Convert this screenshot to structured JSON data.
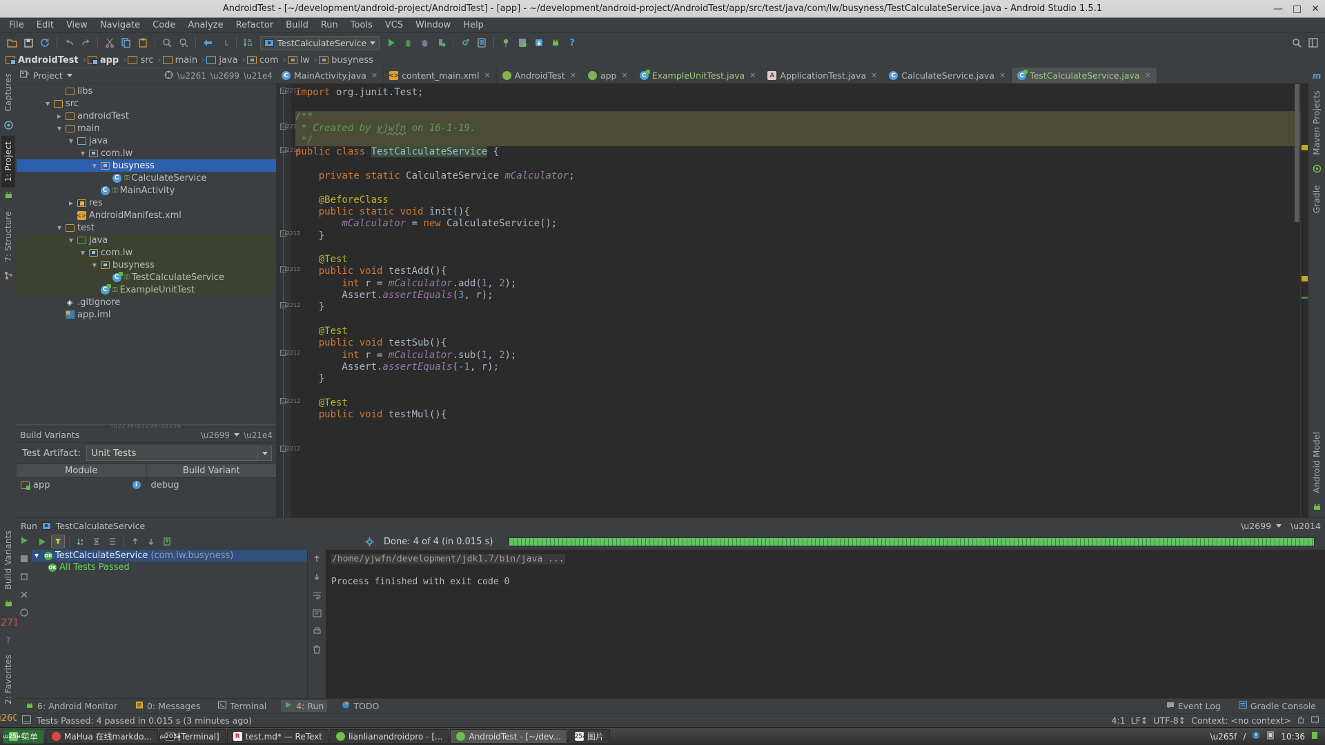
{
  "window": {
    "title": "AndroidTest - [~/development/android-project/AndroidTest] - [app] - ~/development/android-project/AndroidTest/app/src/test/java/com/lw/busyness/TestCalculateService.java - Android Studio 1.5.1",
    "minimize": "—",
    "maximize": "□",
    "close": "✕"
  },
  "menu": {
    "items": [
      "File",
      "Edit",
      "View",
      "Navigate",
      "Code",
      "Analyze",
      "Refactor",
      "Build",
      "Run",
      "Tools",
      "VCS",
      "Window",
      "Help"
    ]
  },
  "toolbar": {
    "run_config": "TestCalculateService",
    "icons": [
      "open-folder-icon",
      "save-all-icon",
      "sync-icon",
      "undo-icon",
      "redo-icon",
      "cut-icon",
      "copy-icon",
      "paste-icon",
      "find-icon",
      "replace-icon",
      "back-icon",
      "forward-icon",
      "sort-icon"
    ],
    "right_icons": [
      "search-everywhere-icon",
      "layout-icon"
    ]
  },
  "breadcrumb": {
    "items": [
      {
        "label": "AndroidTest",
        "icon": "module-icon",
        "bold": true
      },
      {
        "label": "app",
        "icon": "module-icon",
        "bold": true
      },
      {
        "label": "src",
        "icon": "folder-icon",
        "bold": false
      },
      {
        "label": "main",
        "icon": "folder-icon",
        "bold": false
      },
      {
        "label": "java",
        "icon": "source-folder-icon",
        "bold": false
      },
      {
        "label": "com",
        "icon": "package-icon",
        "bold": false
      },
      {
        "label": "lw",
        "icon": "package-icon",
        "bold": false
      },
      {
        "label": "busyness",
        "icon": "package-icon",
        "bold": false
      }
    ],
    "separator": "›"
  },
  "left_stripe": {
    "top": [
      "Captures",
      "1: Project",
      "7: Structure"
    ],
    "bottom": [
      "Build Variants",
      "2: Favorites"
    ]
  },
  "right_stripe": {
    "items": [
      "Maven Projects",
      "Gradle",
      "Android Model"
    ]
  },
  "project_panel": {
    "title": "Project",
    "tree": [
      {
        "label": "libs",
        "indent": 3,
        "arrow": "",
        "icon": "folder-icon",
        "state": "normal"
      },
      {
        "label": "src",
        "indent": 2,
        "arrow": "▼",
        "icon": "folder-icon",
        "state": "normal"
      },
      {
        "label": "androidTest",
        "indent": 3,
        "arrow": "▶",
        "icon": "folder-icon",
        "state": "normal"
      },
      {
        "label": "main",
        "indent": 3,
        "arrow": "▼",
        "icon": "folder-icon",
        "state": "normal"
      },
      {
        "label": "java",
        "indent": 4,
        "arrow": "▼",
        "icon": "source-folder-icon",
        "state": "normal"
      },
      {
        "label": "com.lw",
        "indent": 5,
        "arrow": "▼",
        "icon": "package-icon",
        "state": "normal"
      },
      {
        "label": "busyness",
        "indent": 6,
        "arrow": "▼",
        "icon": "package-icon",
        "state": "selected"
      },
      {
        "label": "CalculateService",
        "indent": 7,
        "arrow": "",
        "icon": "class-icon",
        "state": "normal"
      },
      {
        "label": "MainActivity",
        "indent": 6,
        "arrow": "",
        "icon": "class-icon",
        "state": "normal"
      },
      {
        "label": "res",
        "indent": 4,
        "arrow": "▶",
        "icon": "res-folder-icon",
        "state": "normal"
      },
      {
        "label": "AndroidManifest.xml",
        "indent": 4,
        "arrow": "",
        "icon": "xml-icon",
        "state": "normal"
      },
      {
        "label": "test",
        "indent": 3,
        "arrow": "▼",
        "icon": "folder-icon",
        "state": "normal"
      },
      {
        "label": "java",
        "indent": 4,
        "arrow": "▼",
        "icon": "test-source-folder-icon",
        "state": "test"
      },
      {
        "label": "com.lw",
        "indent": 5,
        "arrow": "▼",
        "icon": "package-icon",
        "state": "test"
      },
      {
        "label": "busyness",
        "indent": 6,
        "arrow": "▼",
        "icon": "package-icon",
        "state": "test"
      },
      {
        "label": "TestCalculateService",
        "indent": 7,
        "arrow": "",
        "icon": "test-class-icon",
        "state": "test"
      },
      {
        "label": "ExampleUnitTest",
        "indent": 6,
        "arrow": "",
        "icon": "test-class-icon",
        "state": "test"
      },
      {
        "label": ".gitignore",
        "indent": 3,
        "arrow": "",
        "icon": "git-icon",
        "state": "normal"
      },
      {
        "label": "app.iml",
        "indent": 3,
        "arrow": "",
        "icon": "iml-icon",
        "state": "normal"
      }
    ]
  },
  "build_variants": {
    "title": "Build Variants",
    "test_artifact_label": "Test Artifact:",
    "test_artifact_value": "Unit Tests",
    "columns": [
      "Module",
      "Build Variant"
    ],
    "rows": [
      {
        "module": "app",
        "variant": "debug"
      }
    ]
  },
  "editor_tabs": [
    {
      "label": "MainActivity.java",
      "icon": "java-class-icon",
      "active": false,
      "color": "normal"
    },
    {
      "label": "content_main.xml",
      "icon": "xml-icon",
      "active": false,
      "color": "normal"
    },
    {
      "label": "AndroidTest",
      "icon": "gradle-icon",
      "active": false,
      "color": "normal"
    },
    {
      "label": "app",
      "icon": "gradle-icon",
      "active": false,
      "color": "normal"
    },
    {
      "label": "ExampleUnitTest.java",
      "icon": "test-class-icon",
      "active": false,
      "color": "green"
    },
    {
      "label": "ApplicationTest.java",
      "icon": "android-test-icon",
      "active": false,
      "color": "normal"
    },
    {
      "label": "CalculateService.java",
      "icon": "java-class-icon",
      "active": false,
      "color": "normal"
    },
    {
      "label": "TestCalculateService.java",
      "icon": "test-class-icon",
      "active": true,
      "color": "green"
    }
  ],
  "editor": {
    "file": "TestCalculateService.java",
    "caret": "4:1",
    "line_separator": "LF",
    "encoding": "UTF-8",
    "context": "Context: <no context>",
    "lines": [
      "import org.junit.Test;",
      "",
      "/**",
      " * Created by yjwfn on 16-1-19.",
      " */",
      "public class TestCalculateService {",
      "",
      "    private static CalculateService mCalculator;",
      "",
      "    @BeforeClass",
      "    public static void init(){",
      "        mCalculator = new CalculateService();",
      "    }",
      "",
      "    @Test",
      "    public void testAdd(){",
      "        int r = mCalculator.add(1, 2);",
      "        Assert.assertEquals(3, r);",
      "    }",
      "",
      "    @Test",
      "    public void testSub(){",
      "        int r = mCalculator.sub(1, 2);",
      "        Assert.assertEquals(-1, r);",
      "    }",
      "",
      "    @Test",
      "    public void testMul(){"
    ]
  },
  "run_window": {
    "title": "Run",
    "config_name": "TestCalculateService",
    "status": "Done: 4 of 4 (in 0.015 s)",
    "tree": [
      {
        "label": "TestCalculateService",
        "suffix": "(com.lw.busyness)",
        "selected": true,
        "arrow": "▼"
      },
      {
        "label": "All Tests Passed",
        "suffix": "",
        "selected": false,
        "arrow": ""
      }
    ],
    "console": {
      "command": "/home/yjwfn/development/jdk1.7/bin/java ...",
      "output": "Process finished with exit code 0"
    },
    "toolbar_icons": [
      "rerun-icon",
      "toggle-auto-test-icon",
      "sort-alphabetically-icon",
      "collapse-all-icon",
      "expand-all-icon",
      "prev-failed-icon",
      "next-failed-icon",
      "export-icon",
      "settings-icon"
    ]
  },
  "tool_window_bar": {
    "items": [
      {
        "label": "6: Android Monitor",
        "icon": "android-icon",
        "active": false
      },
      {
        "label": "0: Messages",
        "icon": "messages-icon",
        "active": false
      },
      {
        "label": "Terminal",
        "icon": "terminal-icon",
        "active": false
      },
      {
        "label": "4: Run",
        "icon": "run-icon",
        "active": true
      },
      {
        "label": "TODO",
        "icon": "todo-icon",
        "active": false
      }
    ],
    "right": [
      {
        "label": "Event Log",
        "icon": "event-log-icon"
      },
      {
        "label": "Gradle Console",
        "icon": "gradle-console-icon"
      }
    ]
  },
  "status_bar": {
    "message": "Tests Passed: 4 passed in 0.015 s (3 minutes ago)",
    "caret": "4:1",
    "line_sep": "LF↕",
    "encoding": "UTF-8↕",
    "context": "Context: <no context>"
  },
  "taskbar": {
    "start": "菜单",
    "items": [
      {
        "label": "MaHua 在线markdo...",
        "icon": "chrome-icon",
        "active": false
      },
      {
        "label": "[Terminal]",
        "icon": "terminal-icon",
        "active": false
      },
      {
        "label": "test.md* — ReText",
        "icon": "retext-icon",
        "active": false
      },
      {
        "label": "lianlianandroidpro - [...",
        "icon": "android-studio-icon",
        "active": false
      },
      {
        "label": "AndroidTest - [~/dev...",
        "icon": "android-studio-icon",
        "active": true
      },
      {
        "label": "图片",
        "icon": "files-icon",
        "active": false
      }
    ],
    "tray": [
      "user-icon",
      "keyboard-layout-icon",
      "network-icon",
      "battery-icon"
    ],
    "clock": "10:36"
  }
}
